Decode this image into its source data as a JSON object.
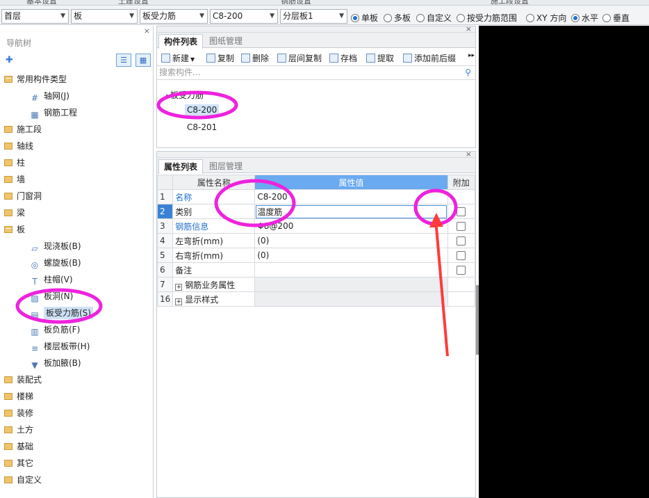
{
  "top_strip": [
    "基本设置",
    "土建设置",
    "钢筋设置",
    "施工段设置"
  ],
  "toolbar": {
    "floor": "首层",
    "category": "板",
    "type": "板受力筋",
    "component": "C8-200",
    "layer": "分层板1",
    "radios": [
      {
        "label": "单板",
        "checked": true
      },
      {
        "label": "多板",
        "checked": false
      },
      {
        "label": "自定义",
        "checked": false
      },
      {
        "label": "按受力筋范围",
        "checked": false
      },
      {
        "label": "XY 方向",
        "checked": false
      },
      {
        "label": "水平",
        "checked": true
      },
      {
        "label": "垂直",
        "checked": false
      }
    ]
  },
  "nav": {
    "title": "导航树",
    "close": "×",
    "items": [
      {
        "label": "常用构件类型",
        "level": 0,
        "open": true
      },
      {
        "label": "轴网(J)",
        "level": 1,
        "icon": "axis-grid-icon"
      },
      {
        "label": "钢筋工程",
        "level": 1,
        "icon": "rebar-project-icon"
      },
      {
        "label": "施工段",
        "level": 0
      },
      {
        "label": "轴线",
        "level": 0
      },
      {
        "label": "柱",
        "level": 0
      },
      {
        "label": "墙",
        "level": 0
      },
      {
        "label": "门窗洞",
        "level": 0
      },
      {
        "label": "梁",
        "level": 0
      },
      {
        "label": "板",
        "level": 0,
        "open": true
      },
      {
        "label": "现浇板(B)",
        "level": 1,
        "icon": "cast-slab-icon"
      },
      {
        "label": "螺旋板(B)",
        "level": 1,
        "icon": "spiral-slab-icon"
      },
      {
        "label": "柱帽(V)",
        "level": 1,
        "icon": "column-cap-icon"
      },
      {
        "label": "板洞(N)",
        "level": 1,
        "icon": "slab-hole-icon"
      },
      {
        "label": "板受力筋(S)",
        "level": 1,
        "icon": "slab-rebar-icon",
        "selected": true
      },
      {
        "label": "板负筋(F)",
        "level": 1,
        "icon": "negative-rebar-icon"
      },
      {
        "label": "楼层板带(H)",
        "level": 1,
        "icon": "slab-strip-icon"
      },
      {
        "label": "板加腋(B)",
        "level": 1,
        "icon": "slab-haunch-icon"
      },
      {
        "label": "装配式",
        "level": 0
      },
      {
        "label": "楼梯",
        "level": 0
      },
      {
        "label": "装修",
        "level": 0
      },
      {
        "label": "土方",
        "level": 0
      },
      {
        "label": "基础",
        "level": 0
      },
      {
        "label": "其它",
        "level": 0
      },
      {
        "label": "自定义",
        "level": 0
      }
    ]
  },
  "component_panel": {
    "tabs": [
      "构件列表",
      "图纸管理"
    ],
    "tools": [
      "新建",
      "复制",
      "删除",
      "层间复制",
      "存档",
      "提取",
      "添加前后缀"
    ],
    "search_placeholder": "搜索构件...",
    "group": "板受力筋",
    "items": [
      "C8-200",
      "C8-201"
    ]
  },
  "property_panel": {
    "tabs": [
      "属性列表",
      "图层管理"
    ],
    "headers": [
      "属性名称",
      "属性值",
      "附加"
    ],
    "rows": [
      {
        "num": "1",
        "name": "名称",
        "value": "C8-200",
        "blue": true,
        "check": false
      },
      {
        "num": "2",
        "name": "类别",
        "value": "温度筋",
        "blue": false,
        "check": true
      },
      {
        "num": "3",
        "name": "钢筋信息",
        "value": "Φ8@200",
        "blue": true,
        "check": true
      },
      {
        "num": "4",
        "name": "左弯折(mm)",
        "value": "(0)",
        "blue": false,
        "check": true
      },
      {
        "num": "5",
        "name": "右弯折(mm)",
        "value": "(0)",
        "blue": false,
        "check": true
      },
      {
        "num": "6",
        "name": "备注",
        "value": "",
        "blue": false,
        "check": true
      },
      {
        "num": "7",
        "name": "钢筋业务属性",
        "value": "",
        "group": true
      },
      {
        "num": "16",
        "name": "显示样式",
        "value": "",
        "group": true
      }
    ]
  },
  "colors": {
    "annotation": "#ee22dd",
    "arrow": "#ff3b3b",
    "accent": "#3b82d6"
  }
}
